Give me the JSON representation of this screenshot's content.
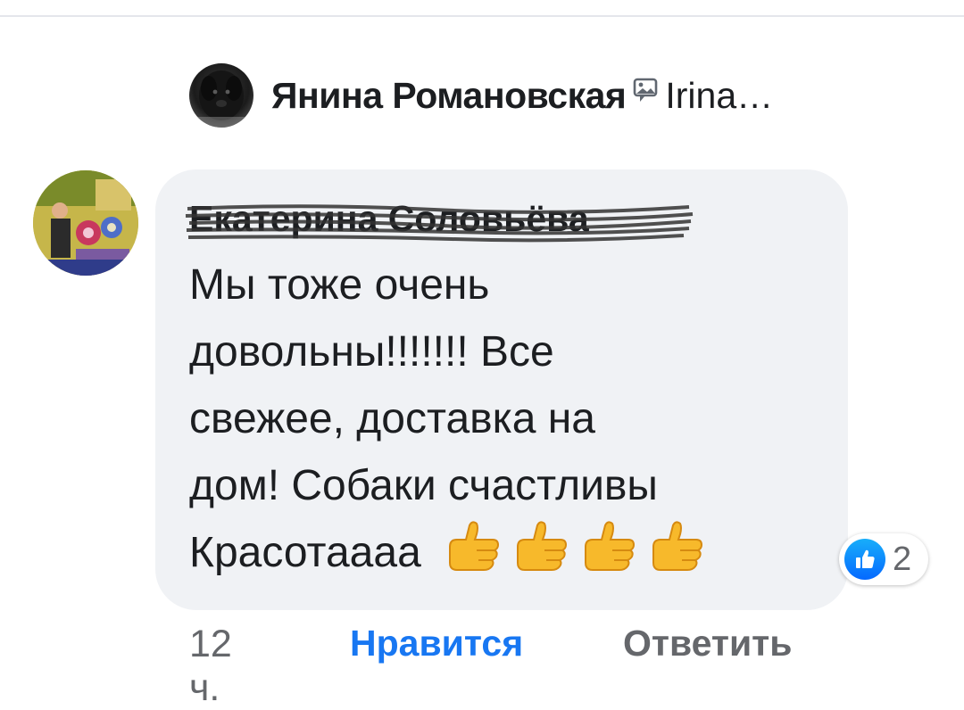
{
  "parent": {
    "author": "Янина Романовская",
    "snippet": "Irina…",
    "attachment_icon": "photo-icon"
  },
  "reply": {
    "author": "Екатерина Соловьёва",
    "text_lines": [
      "Мы тоже очень",
      "довольны!!!!!!! Все",
      "свежее, доставка на",
      "дом! Собаки счастливы"
    ],
    "last_line": "Красотаааа",
    "emoji": [
      "👍",
      "👍",
      "👍",
      "👍"
    ],
    "reaction_icon": "like-icon",
    "reaction_count": "2",
    "time": "12 ч.",
    "like_label": "Нравится",
    "reply_label": "Ответить"
  },
  "colors": {
    "bubble": "#f0f2f5",
    "like_blue": "#1877f2",
    "meta_gray": "#65676b",
    "text": "#1c1e21"
  }
}
